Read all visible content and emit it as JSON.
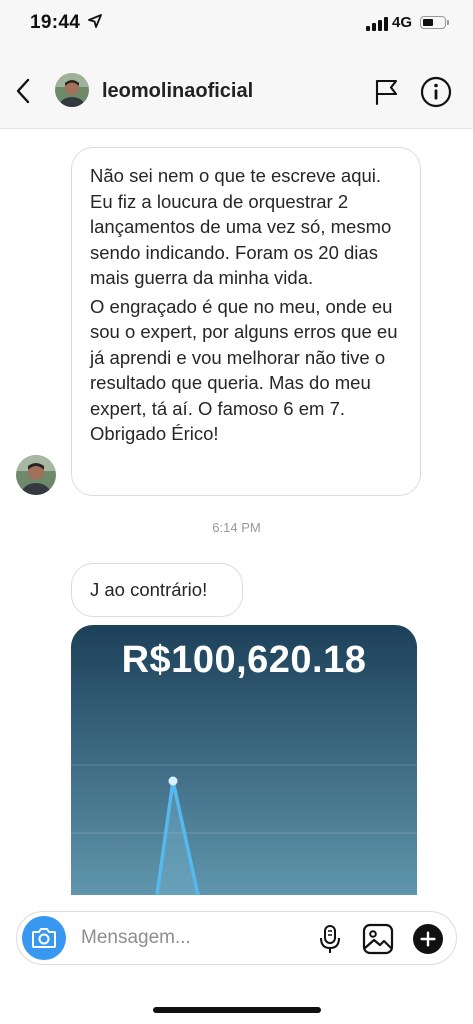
{
  "status_bar": {
    "time": "19:44",
    "network": "4G",
    "battery_level": 0.42
  },
  "header": {
    "username": "leomolinaoficial",
    "back_icon": "chevron-left-icon",
    "flag_icon": "flag-icon",
    "info_icon": "info-icon"
  },
  "messages": [
    {
      "paragraphs": [
        "Não sei nem o que te escreve aqui. Eu fiz a loucura de orquestrar 2 lançamentos de uma vez só, mesmo sendo indicando. Foram os 20 dias mais guerra da minha vida.",
        "O engraçado é que no meu, onde eu sou o expert, por alguns erros que eu já aprendi e vou melhorar não tive o resultado que queria. Mas do meu expert, tá aí. O famoso 6 em 7. Obrigado Érico!"
      ]
    },
    {
      "text": "J ao contrário!"
    }
  ],
  "timestamp": "6:14 PM",
  "media": {
    "amount": "R$100,620.18"
  },
  "composer": {
    "placeholder": "Mensagem...",
    "value": ""
  },
  "colors": {
    "accent": "#3897f0",
    "chart_top": "#1d4059",
    "chart_bottom": "#5f96ad",
    "chart_line": "#55b8ee"
  }
}
